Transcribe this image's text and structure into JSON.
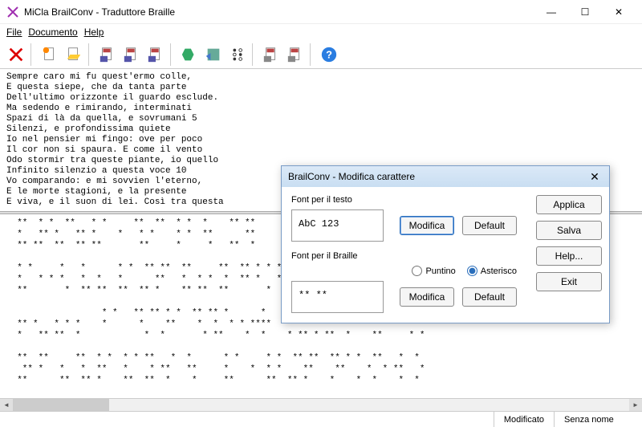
{
  "app": {
    "title": "MiCla BrailConv - Traduttore Braille"
  },
  "menu": {
    "file": "File",
    "documento": "Documento",
    "help": "Help"
  },
  "text_pane": "Sempre caro mi fu quest'ermo colle,\nE questa siepe, che da tanta parte\nDell'ultimo orizzonte il guardo esclude.\nMa sedendo e rimirando, interminati\nSpazi di là da quella, e sovrumani 5\nSilenzi, e profondissima quiete\nIo nel pensier mi fingo: ove per poco\nIl cor non si spaura. E come il vento\nOdo stormir tra queste piante, io quello\nInfinito silenzio a questa voce 10\nVo comparando: e mi sovvien l'eterno,\nE le morte stagioni, e la presente\nE viva, e il suon di lei. Così tra questa",
  "braille_pane": "  **  * *  **   * *     **  **  * *  *    ** **     **  *   *  * *  * *     ** \n  *   ** *   ** *    *   * *    * *  **      **     *   *   *  *   *   * **  **\n  ** **  **  ** **       **     *     *   **  *     *        * ** *    **  * * \n                                                                               \n  * *     *   *      * *  ** **  **     **  ** * * ** *     *      ** ** * *   \n  *   * * *   *  *   *      **   *  * *  *  ** *   **    *   * **  *   *  *    \n  **       *  ** **  **  ** *    ** **  **       *     *    **     **          \n                                                                               \n                  * *   ** ** * *  ** ** *      *   *  ** **  **  *   **    ** \n  ** *   * * *    *      *    **    *  *  * * ****  ** *    *    *  * ** * *  *\n  *   ** **  *            *  *       * **    *  *    * ** * **  *    **     * *\n                                                                               \n  **  **     **  * *  * * **   *  *      * *     * *  ** **  ** * *  **   *  * \n   ** *   *   *  **   *    * **   **     *    *  * *    **    **    *  * **   *\n  **      **  ** *    **  **  *    *     **      **  ** *    *    *  *    *  * ",
  "status": {
    "modified": "Modificato",
    "unnamed": "Senza nome"
  },
  "dialog": {
    "title": "BrailConv - Modifica carattere",
    "font_text_label": "Font per il testo",
    "font_text_sample": "AbC 123",
    "font_braille_label": "Font per il Braille",
    "font_braille_sample": "** **",
    "modifica": "Modifica",
    "default": "Default",
    "puntino": "Puntino",
    "asterisco": "Asterisco",
    "applica": "Applica",
    "salva": "Salva",
    "help": "Help...",
    "exit": "Exit"
  },
  "icons": {
    "delete": "delete-icon",
    "new": "new-doc-icon",
    "open": "open-doc-icon",
    "save_braille": "save-braille-icon",
    "save_text": "save-text-icon",
    "export": "export-icon",
    "shape": "shape-icon",
    "building": "building-icon",
    "braille_dots": "braille-dots-icon",
    "import1": "import-braille-icon",
    "import2": "import-text-icon",
    "help": "help-icon"
  }
}
